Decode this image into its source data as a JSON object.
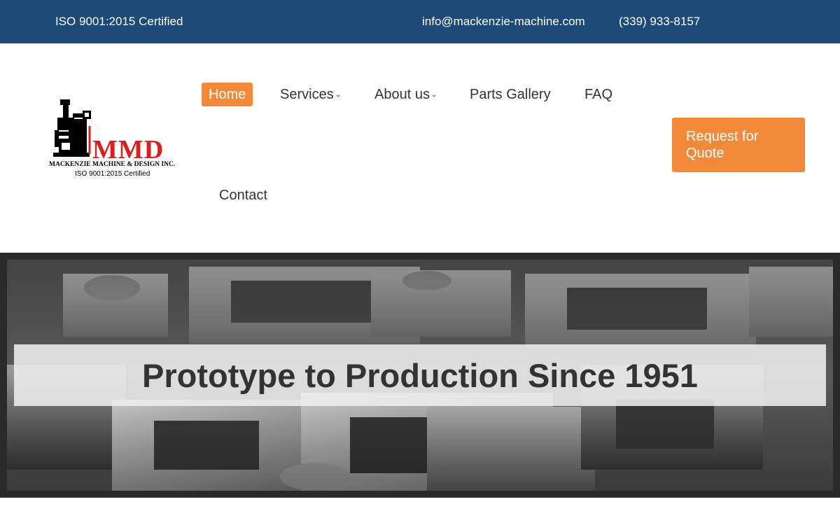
{
  "topbar": {
    "certification": "ISO 9001:2015 Certified",
    "email": "info@mackenzie-machine.com",
    "phone": "(339) 933-8157"
  },
  "logo": {
    "mark": "MMD",
    "company": "MACKENZIE MACHINE & DESIGN INC.",
    "certification": "ISO 9001:2015 Certified"
  },
  "nav": {
    "home": "Home",
    "services": "Services",
    "about": "About us",
    "gallery": "Parts Gallery",
    "faq": "FAQ",
    "contact": "Contact"
  },
  "cta": {
    "line1": "Request for",
    "line2": "Quote"
  },
  "hero": {
    "title": "Prototype to Production Since 1951"
  },
  "colors": {
    "topbar": "#1e4a77",
    "accent": "#f28a3a",
    "brand_red": "#e21b1b"
  }
}
